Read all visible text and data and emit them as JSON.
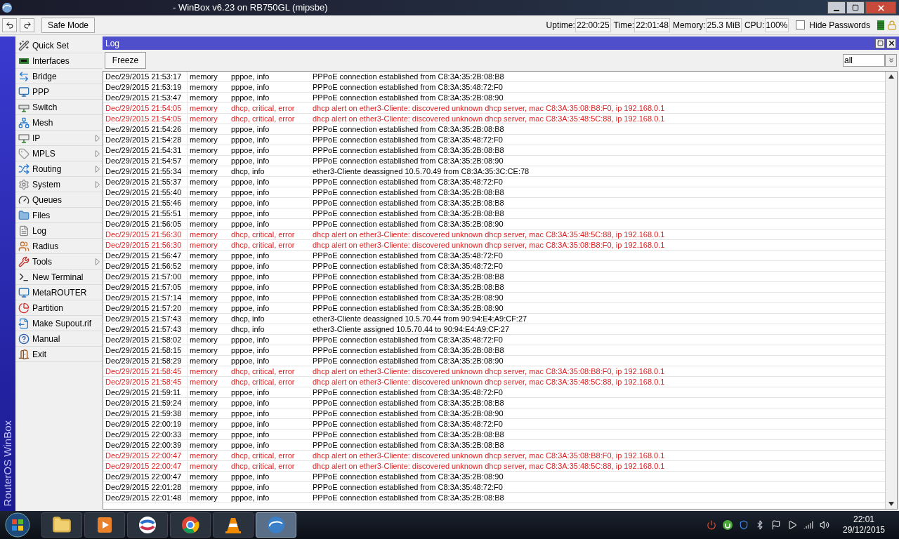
{
  "window": {
    "title": "- WinBox v6.23 on RB750GL (mipsbe)"
  },
  "toolbar": {
    "safe_mode": "Safe Mode",
    "stats": [
      {
        "label": "Uptime:",
        "value": "22:00:25"
      },
      {
        "label": "Time:",
        "value": "22:01:48"
      },
      {
        "label": "Memory:",
        "value": "25.3 MiB"
      },
      {
        "label": "CPU:",
        "value": "100%"
      }
    ],
    "hide_passwords": {
      "label": "Hide Passwords",
      "checked": false
    }
  },
  "brand": "RouterOS WinBox",
  "sidebar": {
    "items": [
      {
        "label": "Quick Set",
        "submenu": false
      },
      {
        "label": "Interfaces",
        "submenu": false
      },
      {
        "label": "Bridge",
        "submenu": false
      },
      {
        "label": "PPP",
        "submenu": false
      },
      {
        "label": "Switch",
        "submenu": false
      },
      {
        "label": "Mesh",
        "submenu": false
      },
      {
        "label": "IP",
        "submenu": true
      },
      {
        "label": "MPLS",
        "submenu": true
      },
      {
        "label": "Routing",
        "submenu": true
      },
      {
        "label": "System",
        "submenu": true
      },
      {
        "label": "Queues",
        "submenu": false
      },
      {
        "label": "Files",
        "submenu": false
      },
      {
        "label": "Log",
        "submenu": false
      },
      {
        "label": "Radius",
        "submenu": false
      },
      {
        "label": "Tools",
        "submenu": true
      },
      {
        "label": "New Terminal",
        "submenu": false
      },
      {
        "label": "MetaROUTER",
        "submenu": false
      },
      {
        "label": "Partition",
        "submenu": false
      },
      {
        "label": "Make Supout.rif",
        "submenu": false
      },
      {
        "label": "Manual",
        "submenu": false
      },
      {
        "label": "Exit",
        "submenu": false
      }
    ]
  },
  "log_window": {
    "title": "Log",
    "freeze": "Freeze",
    "filter": "all",
    "rows": [
      {
        "time": "Dec/29/2015 21:53:17",
        "buffer": "memory",
        "topics": "pppoe, info",
        "message": "PPPoE connection established from C8:3A:35:2B:08:B8",
        "kind": "info"
      },
      {
        "time": "Dec/29/2015 21:53:19",
        "buffer": "memory",
        "topics": "pppoe, info",
        "message": "PPPoE connection established from C8:3A:35:48:72:F0",
        "kind": "info"
      },
      {
        "time": "Dec/29/2015 21:53:47",
        "buffer": "memory",
        "topics": "pppoe, info",
        "message": "PPPoE connection established from C8:3A:35:2B:08:90",
        "kind": "info"
      },
      {
        "time": "Dec/29/2015 21:54:05",
        "buffer": "memory",
        "topics": "dhcp, critical, error",
        "message": "dhcp alert on ether3-Cliente: discovered unknown dhcp server, mac C8:3A:35:08:B8:F0, ip 192.168.0.1",
        "kind": "error"
      },
      {
        "time": "Dec/29/2015 21:54:05",
        "buffer": "memory",
        "topics": "dhcp, critical, error",
        "message": "dhcp alert on ether3-Cliente: discovered unknown dhcp server, mac C8:3A:35:48:5C:88, ip 192.168.0.1",
        "kind": "error"
      },
      {
        "time": "Dec/29/2015 21:54:26",
        "buffer": "memory",
        "topics": "pppoe, info",
        "message": "PPPoE connection established from C8:3A:35:2B:08:B8",
        "kind": "info"
      },
      {
        "time": "Dec/29/2015 21:54:28",
        "buffer": "memory",
        "topics": "pppoe, info",
        "message": "PPPoE connection established from C8:3A:35:48:72:F0",
        "kind": "info"
      },
      {
        "time": "Dec/29/2015 21:54:31",
        "buffer": "memory",
        "topics": "pppoe, info",
        "message": "PPPoE connection established from C8:3A:35:2B:08:B8",
        "kind": "info"
      },
      {
        "time": "Dec/29/2015 21:54:57",
        "buffer": "memory",
        "topics": "pppoe, info",
        "message": "PPPoE connection established from C8:3A:35:2B:08:90",
        "kind": "info"
      },
      {
        "time": "Dec/29/2015 21:55:34",
        "buffer": "memory",
        "topics": "dhcp, info",
        "message": "ether3-Cliente deassigned 10.5.70.49 from C8:3A:35:3C:CE:78",
        "kind": "info"
      },
      {
        "time": "Dec/29/2015 21:55:37",
        "buffer": "memory",
        "topics": "pppoe, info",
        "message": "PPPoE connection established from C8:3A:35:48:72:F0",
        "kind": "info"
      },
      {
        "time": "Dec/29/2015 21:55:40",
        "buffer": "memory",
        "topics": "pppoe, info",
        "message": "PPPoE connection established from C8:3A:35:2B:08:B8",
        "kind": "info"
      },
      {
        "time": "Dec/29/2015 21:55:46",
        "buffer": "memory",
        "topics": "pppoe, info",
        "message": "PPPoE connection established from C8:3A:35:2B:08:B8",
        "kind": "info"
      },
      {
        "time": "Dec/29/2015 21:55:51",
        "buffer": "memory",
        "topics": "pppoe, info",
        "message": "PPPoE connection established from C8:3A:35:2B:08:B8",
        "kind": "info"
      },
      {
        "time": "Dec/29/2015 21:56:05",
        "buffer": "memory",
        "topics": "pppoe, info",
        "message": "PPPoE connection established from C8:3A:35:2B:08:90",
        "kind": "info"
      },
      {
        "time": "Dec/29/2015 21:56:30",
        "buffer": "memory",
        "topics": "dhcp, critical, error",
        "message": "dhcp alert on ether3-Cliente: discovered unknown dhcp server, mac C8:3A:35:48:5C:88, ip 192.168.0.1",
        "kind": "error"
      },
      {
        "time": "Dec/29/2015 21:56:30",
        "buffer": "memory",
        "topics": "dhcp, critical, error",
        "message": "dhcp alert on ether3-Cliente: discovered unknown dhcp server, mac C8:3A:35:08:B8:F0, ip 192.168.0.1",
        "kind": "error"
      },
      {
        "time": "Dec/29/2015 21:56:47",
        "buffer": "memory",
        "topics": "pppoe, info",
        "message": "PPPoE connection established from C8:3A:35:48:72:F0",
        "kind": "info"
      },
      {
        "time": "Dec/29/2015 21:56:52",
        "buffer": "memory",
        "topics": "pppoe, info",
        "message": "PPPoE connection established from C8:3A:35:48:72:F0",
        "kind": "info"
      },
      {
        "time": "Dec/29/2015 21:57:00",
        "buffer": "memory",
        "topics": "pppoe, info",
        "message": "PPPoE connection established from C8:3A:35:2B:08:B8",
        "kind": "info"
      },
      {
        "time": "Dec/29/2015 21:57:05",
        "buffer": "memory",
        "topics": "pppoe, info",
        "message": "PPPoE connection established from C8:3A:35:2B:08:B8",
        "kind": "info"
      },
      {
        "time": "Dec/29/2015 21:57:14",
        "buffer": "memory",
        "topics": "pppoe, info",
        "message": "PPPoE connection established from C8:3A:35:2B:08:90",
        "kind": "info"
      },
      {
        "time": "Dec/29/2015 21:57:20",
        "buffer": "memory",
        "topics": "pppoe, info",
        "message": "PPPoE connection established from C8:3A:35:2B:08:90",
        "kind": "info"
      },
      {
        "time": "Dec/29/2015 21:57:43",
        "buffer": "memory",
        "topics": "dhcp, info",
        "message": "ether3-Cliente deassigned 10.5.70.44 from 90:94:E4:A9:CF:27",
        "kind": "info"
      },
      {
        "time": "Dec/29/2015 21:57:43",
        "buffer": "memory",
        "topics": "dhcp, info",
        "message": "ether3-Cliente assigned 10.5.70.44 to 90:94:E4:A9:CF:27",
        "kind": "info"
      },
      {
        "time": "Dec/29/2015 21:58:02",
        "buffer": "memory",
        "topics": "pppoe, info",
        "message": "PPPoE connection established from C8:3A:35:48:72:F0",
        "kind": "info"
      },
      {
        "time": "Dec/29/2015 21:58:15",
        "buffer": "memory",
        "topics": "pppoe, info",
        "message": "PPPoE connection established from C8:3A:35:2B:08:B8",
        "kind": "info"
      },
      {
        "time": "Dec/29/2015 21:58:29",
        "buffer": "memory",
        "topics": "pppoe, info",
        "message": "PPPoE connection established from C8:3A:35:2B:08:90",
        "kind": "info"
      },
      {
        "time": "Dec/29/2015 21:58:45",
        "buffer": "memory",
        "topics": "dhcp, critical, error",
        "message": "dhcp alert on ether3-Cliente: discovered unknown dhcp server, mac C8:3A:35:08:B8:F0, ip 192.168.0.1",
        "kind": "error"
      },
      {
        "time": "Dec/29/2015 21:58:45",
        "buffer": "memory",
        "topics": "dhcp, critical, error",
        "message": "dhcp alert on ether3-Cliente: discovered unknown dhcp server, mac C8:3A:35:48:5C:88, ip 192.168.0.1",
        "kind": "error"
      },
      {
        "time": "Dec/29/2015 21:59:11",
        "buffer": "memory",
        "topics": "pppoe, info",
        "message": "PPPoE connection established from C8:3A:35:48:72:F0",
        "kind": "info"
      },
      {
        "time": "Dec/29/2015 21:59:24",
        "buffer": "memory",
        "topics": "pppoe, info",
        "message": "PPPoE connection established from C8:3A:35:2B:08:B8",
        "kind": "info"
      },
      {
        "time": "Dec/29/2015 21:59:38",
        "buffer": "memory",
        "topics": "pppoe, info",
        "message": "PPPoE connection established from C8:3A:35:2B:08:90",
        "kind": "info"
      },
      {
        "time": "Dec/29/2015 22:00:19",
        "buffer": "memory",
        "topics": "pppoe, info",
        "message": "PPPoE connection established from C8:3A:35:48:72:F0",
        "kind": "info"
      },
      {
        "time": "Dec/29/2015 22:00:33",
        "buffer": "memory",
        "topics": "pppoe, info",
        "message": "PPPoE connection established from C8:3A:35:2B:08:B8",
        "kind": "info"
      },
      {
        "time": "Dec/29/2015 22:00:39",
        "buffer": "memory",
        "topics": "pppoe, info",
        "message": "PPPoE connection established from C8:3A:35:2B:08:B8",
        "kind": "info"
      },
      {
        "time": "Dec/29/2015 22:00:47",
        "buffer": "memory",
        "topics": "dhcp, critical, error",
        "message": "dhcp alert on ether3-Cliente: discovered unknown dhcp server, mac C8:3A:35:08:B8:F0, ip 192.168.0.1",
        "kind": "error"
      },
      {
        "time": "Dec/29/2015 22:00:47",
        "buffer": "memory",
        "topics": "dhcp, critical, error",
        "message": "dhcp alert on ether3-Cliente: discovered unknown dhcp server, mac C8:3A:35:48:5C:88, ip 192.168.0.1",
        "kind": "error"
      },
      {
        "time": "Dec/29/2015 22:00:47",
        "buffer": "memory",
        "topics": "pppoe, info",
        "message": "PPPoE connection established from C8:3A:35:2B:08:90",
        "kind": "info"
      },
      {
        "time": "Dec/29/2015 22:01:28",
        "buffer": "memory",
        "topics": "pppoe, info",
        "message": "PPPoE connection established from C8:3A:35:48:72:F0",
        "kind": "info"
      },
      {
        "time": "Dec/29/2015 22:01:48",
        "buffer": "memory",
        "topics": "pppoe, info",
        "message": "PPPoE connection established from C8:3A:35:2B:08:B8",
        "kind": "info"
      }
    ]
  },
  "taskbar": {
    "apps": [
      {
        "selected": false
      },
      {
        "selected": false
      },
      {
        "selected": false
      },
      {
        "selected": false
      },
      {
        "selected": false
      },
      {
        "selected": true
      }
    ],
    "clock": {
      "time": "22:01",
      "date": "29/12/2015"
    }
  }
}
